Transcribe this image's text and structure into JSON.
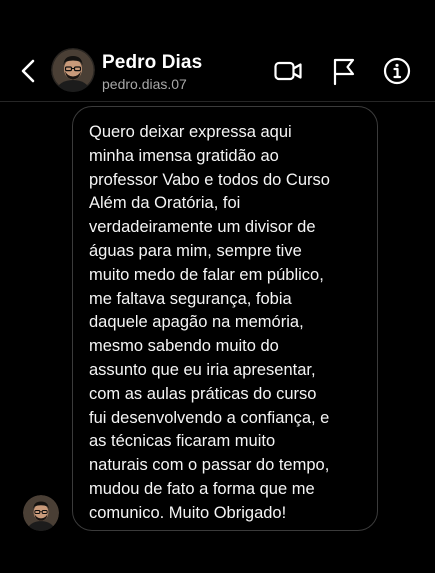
{
  "header": {
    "name": "Pedro Dias",
    "username": "pedro.dias.07"
  },
  "icons": {
    "back": "chevron-left-icon",
    "video": "video-camera-icon",
    "flag": "flag-icon",
    "info": "info-icon"
  },
  "message": {
    "text": "Quero deixar expressa aqui\nminha imensa gratidão ao\nprofessor Vabo e todos do Curso\nAlém da Oratória, foi\nverdadeiramente um divisor de\náguas para mim, sempre tive\nmuito medo de falar em público,\nme faltava segurança, fobia\ndaquele apagão na memória,\nmesmo sabendo muito do\nassunto que eu iria apresentar,\ncom as aulas práticas do curso\nfui desenvolvendo a confiança, e\nas técnicas ficaram muito\nnaturais com o passar do tempo,\nmudou de fato a forma que me\ncomunico. Muito Obrigado!"
  },
  "colors": {
    "background": "#000000",
    "text": "#ffffff",
    "secondary_text": "#a8a8a8",
    "bubble_border": "#3b3b3b"
  }
}
